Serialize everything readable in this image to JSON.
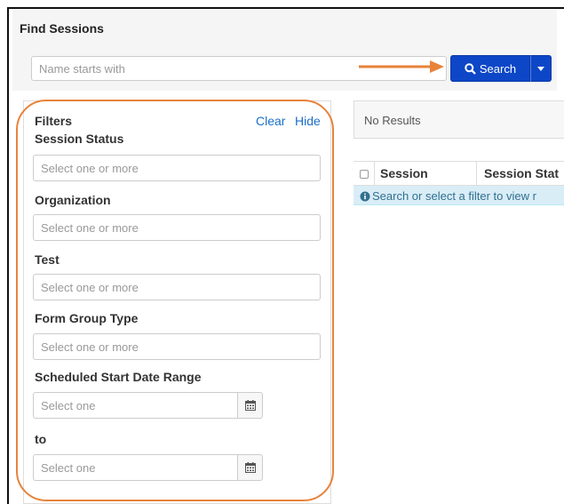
{
  "header": {
    "title": "Find Sessions"
  },
  "search": {
    "placeholder": "Name starts with",
    "button_label": "Search"
  },
  "filters": {
    "title": "Filters",
    "clear_label": "Clear",
    "hide_label": "Hide",
    "fields": [
      {
        "label": "Session Status",
        "placeholder": "Select one or more"
      },
      {
        "label": "Organization",
        "placeholder": "Select one or more"
      },
      {
        "label": "Test",
        "placeholder": "Select one or more"
      },
      {
        "label": "Form Group Type",
        "placeholder": "Select one or more"
      }
    ],
    "date_range": {
      "label": "Scheduled Start Date Range",
      "start_placeholder": "Select one",
      "to_label": "to",
      "end_placeholder": "Select one"
    }
  },
  "results": {
    "status": "No Results",
    "columns": [
      "Session",
      "Session Stat"
    ],
    "info_message": "Search or select a filter to view r"
  },
  "colors": {
    "primary": "#0d47c7",
    "annotation": "#e8833a",
    "link": "#1a6fc9",
    "info_bg": "#d9edf7"
  },
  "icons": [
    "search-icon",
    "caret-down-icon",
    "calendar-icon",
    "info-icon",
    "arrow-annotation"
  ]
}
